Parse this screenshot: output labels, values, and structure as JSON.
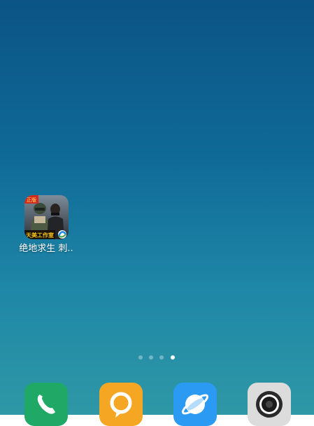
{
  "home_screen": {
    "apps": [
      {
        "label": "绝地求生 刺..",
        "icon": "pubg-game-icon",
        "badge_text": "正版",
        "publisher_text": "天美工作室"
      }
    ],
    "page_indicator": {
      "total_pages": 4,
      "current_page": 4
    }
  },
  "dock": {
    "apps": [
      {
        "icon": "phone-icon",
        "color": "#1fa866"
      },
      {
        "icon": "message-bubble-icon",
        "color": "#f5a623"
      },
      {
        "icon": "browser-icon",
        "color": "#2a9af3"
      },
      {
        "icon": "camera-icon",
        "color": "#dcdcdc"
      }
    ]
  },
  "colors": {
    "wallpaper_top": "#0b5485",
    "wallpaper_bottom": "#2e98a6"
  }
}
